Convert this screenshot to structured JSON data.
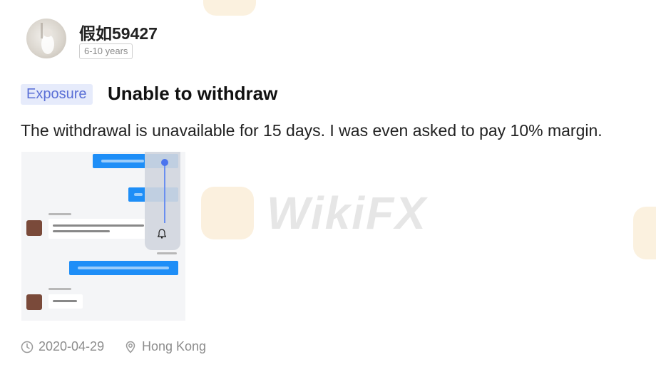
{
  "user": {
    "name": "假如59427",
    "experience": "6-10 years"
  },
  "post": {
    "tag": "Exposure",
    "title": "Unable to withdraw",
    "body": "The withdrawal is unavailable for 15 days. I was even asked to pay 10% margin.",
    "date": "2020-04-29",
    "location": "Hong Kong"
  },
  "watermark": {
    "text": "WikiFX"
  },
  "icons": {
    "clock": "clock-icon",
    "location": "location-pin-icon"
  },
  "colors": {
    "tag_bg": "#e6ebfb",
    "tag_text": "#5a6fd6",
    "chat_blue": "#1e8ef7",
    "muted": "#8c8c8c"
  }
}
